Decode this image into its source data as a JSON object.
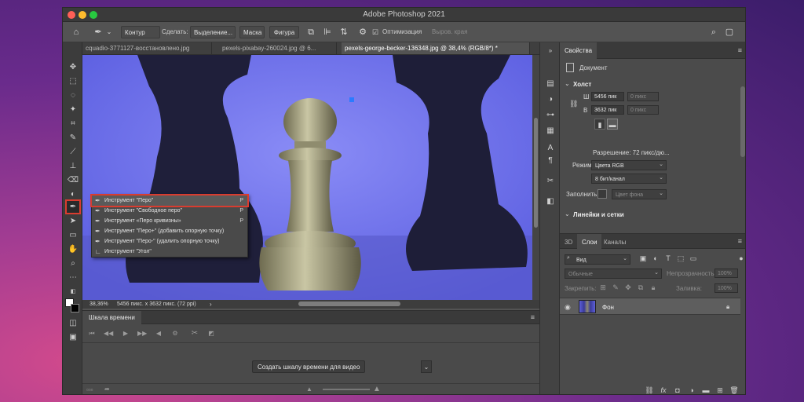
{
  "window": {
    "title": "Adobe Photoshop 2021"
  },
  "options_bar": {
    "home_icon": "home-icon",
    "tool_icon": "pen-icon",
    "mode": "Контур",
    "make_label": "Сделать:",
    "selection_btn": "Выделение...",
    "mask_btn": "Маска",
    "shape_btn": "Фигура",
    "optimize_label": "Оптимизация",
    "align_placeholder": "Выров. края"
  },
  "tabs": [
    {
      "label": "cquadio-3771127-восстановлено.jpg"
    },
    {
      "label": "pexels-pixabay-260024.jpg @ 6..."
    },
    {
      "label": "pexels-george-becker-136348.jpg @ 38,4% (RGB/8*) *"
    }
  ],
  "tool_flyout": [
    {
      "label": "Инструмент \"Перо\"",
      "key": "P"
    },
    {
      "label": "Инструмент \"Свободное перо\"",
      "key": "P"
    },
    {
      "label": "Инструмент «Перо кривизны»",
      "key": "P"
    },
    {
      "label": "Инструмент \"Перо+\" (добавить опорную точку)",
      "key": ""
    },
    {
      "label": "Инструмент \"Перо-\" (удалить опорную точку)",
      "key": ""
    },
    {
      "label": "Инструмент \"Угол\"",
      "key": ""
    }
  ],
  "status": {
    "zoom": "38,36%",
    "info": "5456 пикс. x 3632 пикс. (72 ppi)"
  },
  "timeline": {
    "tab": "Шкала времени",
    "create_btn": "Создать шкалу времени для видео"
  },
  "properties": {
    "tab": "Свойства",
    "doc_label": "Документ",
    "canvas_section": "Холст",
    "w_label": "Ш",
    "w_value": "5456 пик",
    "w_extra": "0 пикс",
    "h_label": "В",
    "h_value": "3632 пик",
    "h_extra": "0 пикс",
    "resolution": "Разрешение: 72 пикс/дю...",
    "mode_label": "Режим",
    "mode_value": "Цвета RGB",
    "bits_value": "8 бит/канал",
    "fill_label": "Заполнить",
    "fill_value": "Цвет фона",
    "rulers_section": "Линейки и сетки"
  },
  "layers_panel": {
    "tab_3d": "3D",
    "tab_layers": "Слои",
    "tab_channels": "Каналы",
    "search": "Вид",
    "blend": "Обычные",
    "opacity_label": "Непрозрачность:",
    "opacity_value": "100%",
    "lock_label": "Закрепить:",
    "fill_label": "Заливка:",
    "fill_value": "100%",
    "layer_name": "Фон"
  }
}
